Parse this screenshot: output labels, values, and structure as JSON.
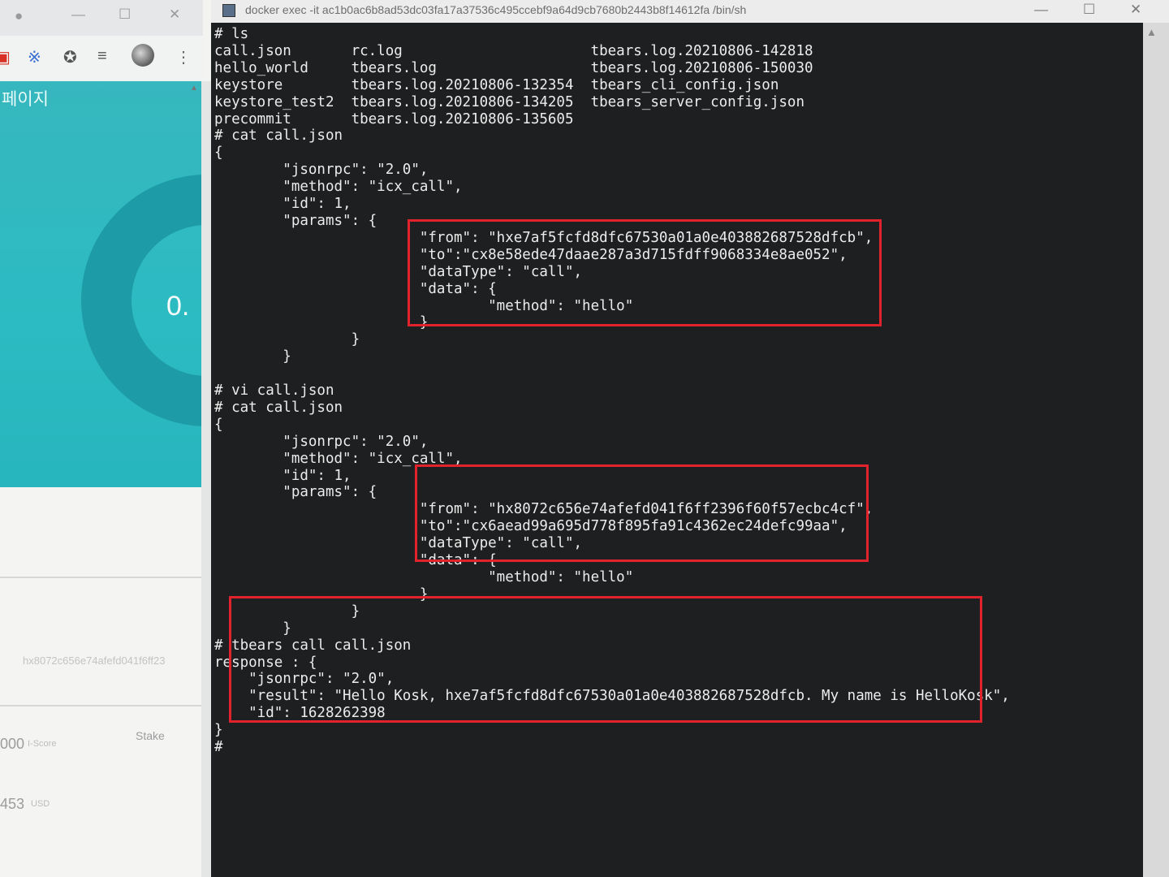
{
  "browser": {
    "page_title": "페이지",
    "donut_value": "0.",
    "address": "hx8072c656e74afefd041f6ff23",
    "stake_label": "Stake",
    "iscore_amount": "000",
    "iscore_unit": "I-Score",
    "usd_amount": "453",
    "usd_unit": "USD"
  },
  "terminal": {
    "title": "docker  exec -it ac1b0ac6b8ad53dc03fa17a37536c495ccebf9a64d9cb7680b2443b8f14612fa /bin/sh",
    "lines": [
      "# ls",
      "call.json       rc.log                      tbears.log.20210806-142818",
      "hello_world     tbears.log                  tbears.log.20210806-150030",
      "keystore        tbears.log.20210806-132354  tbears_cli_config.json",
      "keystore_test2  tbears.log.20210806-134205  tbears_server_config.json",
      "precommit       tbears.log.20210806-135605",
      "# cat call.json",
      "{",
      "        \"jsonrpc\": \"2.0\",",
      "        \"method\": \"icx_call\",",
      "        \"id\": 1,",
      "        \"params\": {",
      "                        \"from\": \"hxe7af5fcfd8dfc67530a01a0e403882687528dfcb\",",
      "                        \"to\":\"cx8e58ede47daae287a3d715fdff9068334e8ae052\",",
      "                        \"dataType\": \"call\",",
      "                        \"data\": {",
      "                                \"method\": \"hello\"",
      "                        }",
      "                }",
      "        }",
      "",
      "# vi call.json",
      "# cat call.json",
      "{",
      "        \"jsonrpc\": \"2.0\",",
      "        \"method\": \"icx_call\",",
      "        \"id\": 1,",
      "        \"params\": {",
      "                        \"from\": \"hx8072c656e74afefd041f6ff2396f60f57ecbc4cf\",",
      "                        \"to\":\"cx6aead99a695d778f895fa91c4362ec24defc99aa\",",
      "                        \"dataType\": \"call\",",
      "                        \"data\": {",
      "                                \"method\": \"hello\"",
      "                        }",
      "                }",
      "        }",
      "# tbears call call.json",
      "response : {",
      "    \"jsonrpc\": \"2.0\",",
      "    \"result\": \"Hello Kosk, hxe7af5fcfd8dfc67530a01a0e403882687528dfcb. My name is HelloKosk\",",
      "    \"id\": 1628262398",
      "}",
      "#"
    ]
  }
}
